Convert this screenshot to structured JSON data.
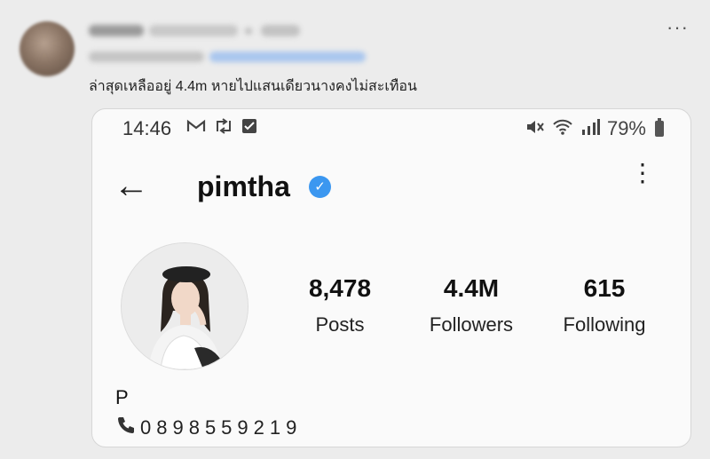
{
  "post": {
    "caption": "ล่าสุดเหลืออยู่ 4.4m หายไปแสนเดียวนางคงไม่สะเทือน",
    "more_label": "···"
  },
  "phone_screenshot": {
    "status_bar": {
      "time": "14:46",
      "battery": "79%",
      "icons": [
        "gmail-icon",
        "retweet-icon",
        "checkbox-icon",
        "mute-icon",
        "wifi-icon",
        "signal-icon",
        "battery-icon"
      ]
    },
    "header": {
      "back_icon": "←",
      "username": "pimtha",
      "verified_mark": "✓",
      "menu_icon": "⋮"
    },
    "stats": [
      {
        "value": "8,478",
        "label": "Posts"
      },
      {
        "value": "4.4M",
        "label": "Followers"
      },
      {
        "value": "615",
        "label": "Following"
      }
    ],
    "bio": {
      "name": "P",
      "phone_icon": "📞",
      "phone": "0898559219"
    }
  },
  "colors": {
    "verified": "#3b97f0",
    "page_bg": "#ececec",
    "card_bg": "#fafafa"
  }
}
